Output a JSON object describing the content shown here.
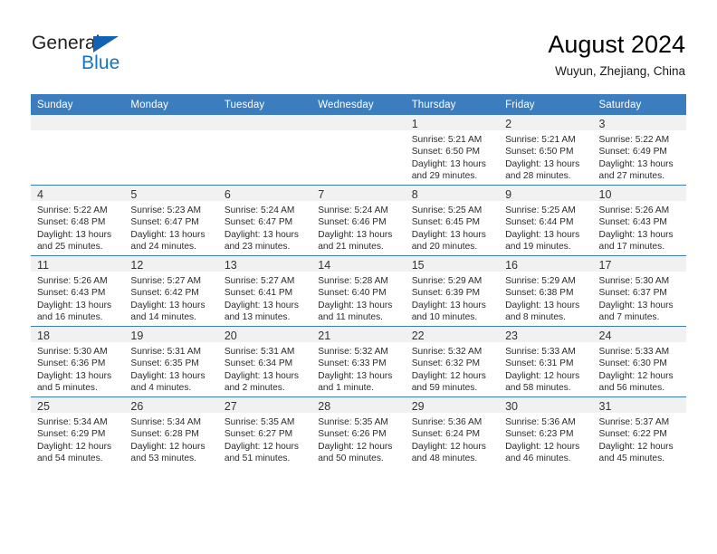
{
  "brand": {
    "name_part1": "General",
    "name_part2": "Blue",
    "triangle_color": "#1262b3",
    "blue_color": "#1474c4"
  },
  "header": {
    "title": "August 2024",
    "subtitle": "Wuyun, Zhejiang, China"
  },
  "theme": {
    "header_blue": "#3c7dbf",
    "daynum_band": "#f1f1f1",
    "text": "#2b2b2b"
  },
  "weekday_headers": [
    "Sunday",
    "Monday",
    "Tuesday",
    "Wednesday",
    "Thursday",
    "Friday",
    "Saturday"
  ],
  "labels": {
    "sunrise": "Sunrise:",
    "sunset": "Sunset:",
    "daylight": "Daylight:"
  },
  "weeks": [
    [
      {
        "day": "",
        "sunrise": "",
        "sunset": "",
        "daylight": "",
        "empty": true
      },
      {
        "day": "",
        "sunrise": "",
        "sunset": "",
        "daylight": "",
        "empty": true
      },
      {
        "day": "",
        "sunrise": "",
        "sunset": "",
        "daylight": "",
        "empty": true
      },
      {
        "day": "",
        "sunrise": "",
        "sunset": "",
        "daylight": "",
        "empty": true
      },
      {
        "day": "1",
        "sunrise": "Sunrise: 5:21 AM",
        "sunset": "Sunset: 6:50 PM",
        "daylight": "Daylight: 13 hours and 29 minutes.",
        "empty": false
      },
      {
        "day": "2",
        "sunrise": "Sunrise: 5:21 AM",
        "sunset": "Sunset: 6:50 PM",
        "daylight": "Daylight: 13 hours and 28 minutes.",
        "empty": false
      },
      {
        "day": "3",
        "sunrise": "Sunrise: 5:22 AM",
        "sunset": "Sunset: 6:49 PM",
        "daylight": "Daylight: 13 hours and 27 minutes.",
        "empty": false
      }
    ],
    [
      {
        "day": "4",
        "sunrise": "Sunrise: 5:22 AM",
        "sunset": "Sunset: 6:48 PM",
        "daylight": "Daylight: 13 hours and 25 minutes.",
        "empty": false
      },
      {
        "day": "5",
        "sunrise": "Sunrise: 5:23 AM",
        "sunset": "Sunset: 6:47 PM",
        "daylight": "Daylight: 13 hours and 24 minutes.",
        "empty": false
      },
      {
        "day": "6",
        "sunrise": "Sunrise: 5:24 AM",
        "sunset": "Sunset: 6:47 PM",
        "daylight": "Daylight: 13 hours and 23 minutes.",
        "empty": false
      },
      {
        "day": "7",
        "sunrise": "Sunrise: 5:24 AM",
        "sunset": "Sunset: 6:46 PM",
        "daylight": "Daylight: 13 hours and 21 minutes.",
        "empty": false
      },
      {
        "day": "8",
        "sunrise": "Sunrise: 5:25 AM",
        "sunset": "Sunset: 6:45 PM",
        "daylight": "Daylight: 13 hours and 20 minutes.",
        "empty": false
      },
      {
        "day": "9",
        "sunrise": "Sunrise: 5:25 AM",
        "sunset": "Sunset: 6:44 PM",
        "daylight": "Daylight: 13 hours and 19 minutes.",
        "empty": false
      },
      {
        "day": "10",
        "sunrise": "Sunrise: 5:26 AM",
        "sunset": "Sunset: 6:43 PM",
        "daylight": "Daylight: 13 hours and 17 minutes.",
        "empty": false
      }
    ],
    [
      {
        "day": "11",
        "sunrise": "Sunrise: 5:26 AM",
        "sunset": "Sunset: 6:43 PM",
        "daylight": "Daylight: 13 hours and 16 minutes.",
        "empty": false
      },
      {
        "day": "12",
        "sunrise": "Sunrise: 5:27 AM",
        "sunset": "Sunset: 6:42 PM",
        "daylight": "Daylight: 13 hours and 14 minutes.",
        "empty": false
      },
      {
        "day": "13",
        "sunrise": "Sunrise: 5:27 AM",
        "sunset": "Sunset: 6:41 PM",
        "daylight": "Daylight: 13 hours and 13 minutes.",
        "empty": false
      },
      {
        "day": "14",
        "sunrise": "Sunrise: 5:28 AM",
        "sunset": "Sunset: 6:40 PM",
        "daylight": "Daylight: 13 hours and 11 minutes.",
        "empty": false
      },
      {
        "day": "15",
        "sunrise": "Sunrise: 5:29 AM",
        "sunset": "Sunset: 6:39 PM",
        "daylight": "Daylight: 13 hours and 10 minutes.",
        "empty": false
      },
      {
        "day": "16",
        "sunrise": "Sunrise: 5:29 AM",
        "sunset": "Sunset: 6:38 PM",
        "daylight": "Daylight: 13 hours and 8 minutes.",
        "empty": false
      },
      {
        "day": "17",
        "sunrise": "Sunrise: 5:30 AM",
        "sunset": "Sunset: 6:37 PM",
        "daylight": "Daylight: 13 hours and 7 minutes.",
        "empty": false
      }
    ],
    [
      {
        "day": "18",
        "sunrise": "Sunrise: 5:30 AM",
        "sunset": "Sunset: 6:36 PM",
        "daylight": "Daylight: 13 hours and 5 minutes.",
        "empty": false
      },
      {
        "day": "19",
        "sunrise": "Sunrise: 5:31 AM",
        "sunset": "Sunset: 6:35 PM",
        "daylight": "Daylight: 13 hours and 4 minutes.",
        "empty": false
      },
      {
        "day": "20",
        "sunrise": "Sunrise: 5:31 AM",
        "sunset": "Sunset: 6:34 PM",
        "daylight": "Daylight: 13 hours and 2 minutes.",
        "empty": false
      },
      {
        "day": "21",
        "sunrise": "Sunrise: 5:32 AM",
        "sunset": "Sunset: 6:33 PM",
        "daylight": "Daylight: 13 hours and 1 minute.",
        "empty": false
      },
      {
        "day": "22",
        "sunrise": "Sunrise: 5:32 AM",
        "sunset": "Sunset: 6:32 PM",
        "daylight": "Daylight: 12 hours and 59 minutes.",
        "empty": false
      },
      {
        "day": "23",
        "sunrise": "Sunrise: 5:33 AM",
        "sunset": "Sunset: 6:31 PM",
        "daylight": "Daylight: 12 hours and 58 minutes.",
        "empty": false
      },
      {
        "day": "24",
        "sunrise": "Sunrise: 5:33 AM",
        "sunset": "Sunset: 6:30 PM",
        "daylight": "Daylight: 12 hours and 56 minutes.",
        "empty": false
      }
    ],
    [
      {
        "day": "25",
        "sunrise": "Sunrise: 5:34 AM",
        "sunset": "Sunset: 6:29 PM",
        "daylight": "Daylight: 12 hours and 54 minutes.",
        "empty": false
      },
      {
        "day": "26",
        "sunrise": "Sunrise: 5:34 AM",
        "sunset": "Sunset: 6:28 PM",
        "daylight": "Daylight: 12 hours and 53 minutes.",
        "empty": false
      },
      {
        "day": "27",
        "sunrise": "Sunrise: 5:35 AM",
        "sunset": "Sunset: 6:27 PM",
        "daylight": "Daylight: 12 hours and 51 minutes.",
        "empty": false
      },
      {
        "day": "28",
        "sunrise": "Sunrise: 5:35 AM",
        "sunset": "Sunset: 6:26 PM",
        "daylight": "Daylight: 12 hours and 50 minutes.",
        "empty": false
      },
      {
        "day": "29",
        "sunrise": "Sunrise: 5:36 AM",
        "sunset": "Sunset: 6:24 PM",
        "daylight": "Daylight: 12 hours and 48 minutes.",
        "empty": false
      },
      {
        "day": "30",
        "sunrise": "Sunrise: 5:36 AM",
        "sunset": "Sunset: 6:23 PM",
        "daylight": "Daylight: 12 hours and 46 minutes.",
        "empty": false
      },
      {
        "day": "31",
        "sunrise": "Sunrise: 5:37 AM",
        "sunset": "Sunset: 6:22 PM",
        "daylight": "Daylight: 12 hours and 45 minutes.",
        "empty": false
      }
    ]
  ]
}
